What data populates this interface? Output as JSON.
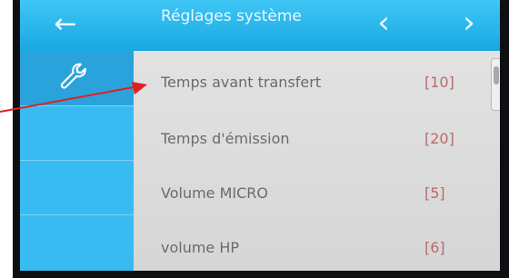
{
  "topbar": {
    "back_icon": "arrow-left-icon",
    "title": "Réglages système",
    "prev_icon": "chevron-left-icon",
    "next_icon": "chevron-right-icon"
  },
  "sidebar": {
    "items": [
      {
        "icon": "wrench-icon",
        "selected": true
      }
    ]
  },
  "settings": {
    "rows": [
      {
        "label": "Temps avant transfert",
        "value": "[10]"
      },
      {
        "label": "Temps d'émission",
        "value": "[20]"
      },
      {
        "label": "Volume MICRO",
        "value": "[5]"
      },
      {
        "label": "volume HP",
        "value": "[6]"
      }
    ]
  },
  "colors": {
    "topbar": "#19a8e2",
    "sidebar": "#38bbf0",
    "value_text": "#b96a6a",
    "annotation_arrow": "#e21e1e"
  }
}
